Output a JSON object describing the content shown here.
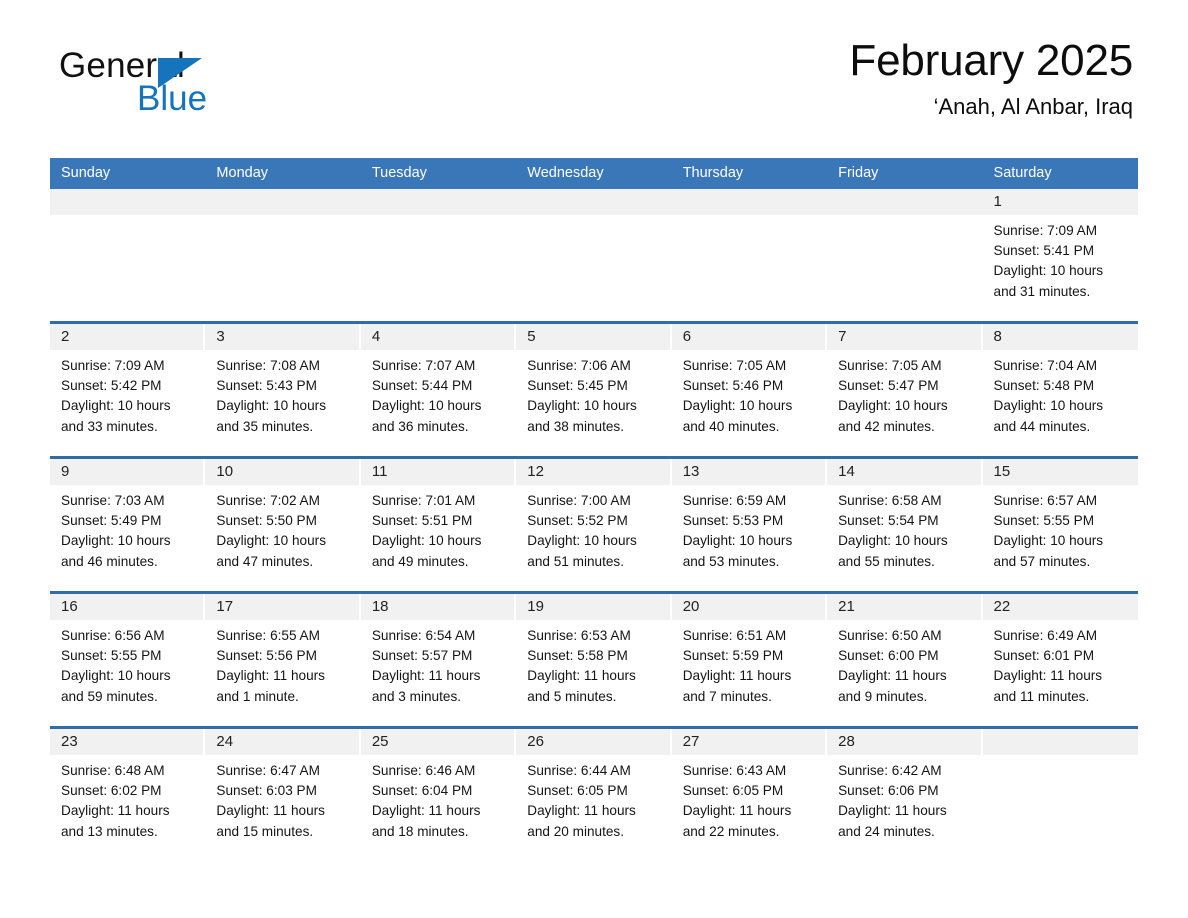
{
  "brand": {
    "name_part1": "General",
    "name_part2": "Blue",
    "accent_color": "#1574bb",
    "triangle_icon": "triangle-icon"
  },
  "header": {
    "month_title": "February 2025",
    "location": "‘Anah, Al Anbar, Iraq"
  },
  "calendar": {
    "header_color": "#3a77b8",
    "row_separator_color": "#2f6ca8",
    "daynum_strip_color": "#f1f1f1",
    "weekdays": [
      "Sunday",
      "Monday",
      "Tuesday",
      "Wednesday",
      "Thursday",
      "Friday",
      "Saturday"
    ],
    "weeks": [
      [
        {
          "empty": true
        },
        {
          "empty": true
        },
        {
          "empty": true
        },
        {
          "empty": true
        },
        {
          "empty": true
        },
        {
          "empty": true
        },
        {
          "day": "1",
          "sunrise": "Sunrise: 7:09 AM",
          "sunset": "Sunset: 5:41 PM",
          "daylight": "Daylight: 10 hours and 31 minutes."
        }
      ],
      [
        {
          "day": "2",
          "sunrise": "Sunrise: 7:09 AM",
          "sunset": "Sunset: 5:42 PM",
          "daylight": "Daylight: 10 hours and 33 minutes."
        },
        {
          "day": "3",
          "sunrise": "Sunrise: 7:08 AM",
          "sunset": "Sunset: 5:43 PM",
          "daylight": "Daylight: 10 hours and 35 minutes."
        },
        {
          "day": "4",
          "sunrise": "Sunrise: 7:07 AM",
          "sunset": "Sunset: 5:44 PM",
          "daylight": "Daylight: 10 hours and 36 minutes."
        },
        {
          "day": "5",
          "sunrise": "Sunrise: 7:06 AM",
          "sunset": "Sunset: 5:45 PM",
          "daylight": "Daylight: 10 hours and 38 minutes."
        },
        {
          "day": "6",
          "sunrise": "Sunrise: 7:05 AM",
          "sunset": "Sunset: 5:46 PM",
          "daylight": "Daylight: 10 hours and 40 minutes."
        },
        {
          "day": "7",
          "sunrise": "Sunrise: 7:05 AM",
          "sunset": "Sunset: 5:47 PM",
          "daylight": "Daylight: 10 hours and 42 minutes."
        },
        {
          "day": "8",
          "sunrise": "Sunrise: 7:04 AM",
          "sunset": "Sunset: 5:48 PM",
          "daylight": "Daylight: 10 hours and 44 minutes."
        }
      ],
      [
        {
          "day": "9",
          "sunrise": "Sunrise: 7:03 AM",
          "sunset": "Sunset: 5:49 PM",
          "daylight": "Daylight: 10 hours and 46 minutes."
        },
        {
          "day": "10",
          "sunrise": "Sunrise: 7:02 AM",
          "sunset": "Sunset: 5:50 PM",
          "daylight": "Daylight: 10 hours and 47 minutes."
        },
        {
          "day": "11",
          "sunrise": "Sunrise: 7:01 AM",
          "sunset": "Sunset: 5:51 PM",
          "daylight": "Daylight: 10 hours and 49 minutes."
        },
        {
          "day": "12",
          "sunrise": "Sunrise: 7:00 AM",
          "sunset": "Sunset: 5:52 PM",
          "daylight": "Daylight: 10 hours and 51 minutes."
        },
        {
          "day": "13",
          "sunrise": "Sunrise: 6:59 AM",
          "sunset": "Sunset: 5:53 PM",
          "daylight": "Daylight: 10 hours and 53 minutes."
        },
        {
          "day": "14",
          "sunrise": "Sunrise: 6:58 AM",
          "sunset": "Sunset: 5:54 PM",
          "daylight": "Daylight: 10 hours and 55 minutes."
        },
        {
          "day": "15",
          "sunrise": "Sunrise: 6:57 AM",
          "sunset": "Sunset: 5:55 PM",
          "daylight": "Daylight: 10 hours and 57 minutes."
        }
      ],
      [
        {
          "day": "16",
          "sunrise": "Sunrise: 6:56 AM",
          "sunset": "Sunset: 5:55 PM",
          "daylight": "Daylight: 10 hours and 59 minutes."
        },
        {
          "day": "17",
          "sunrise": "Sunrise: 6:55 AM",
          "sunset": "Sunset: 5:56 PM",
          "daylight": "Daylight: 11 hours and 1 minute."
        },
        {
          "day": "18",
          "sunrise": "Sunrise: 6:54 AM",
          "sunset": "Sunset: 5:57 PM",
          "daylight": "Daylight: 11 hours and 3 minutes."
        },
        {
          "day": "19",
          "sunrise": "Sunrise: 6:53 AM",
          "sunset": "Sunset: 5:58 PM",
          "daylight": "Daylight: 11 hours and 5 minutes."
        },
        {
          "day": "20",
          "sunrise": "Sunrise: 6:51 AM",
          "sunset": "Sunset: 5:59 PM",
          "daylight": "Daylight: 11 hours and 7 minutes."
        },
        {
          "day": "21",
          "sunrise": "Sunrise: 6:50 AM",
          "sunset": "Sunset: 6:00 PM",
          "daylight": "Daylight: 11 hours and 9 minutes."
        },
        {
          "day": "22",
          "sunrise": "Sunrise: 6:49 AM",
          "sunset": "Sunset: 6:01 PM",
          "daylight": "Daylight: 11 hours and 11 minutes."
        }
      ],
      [
        {
          "day": "23",
          "sunrise": "Sunrise: 6:48 AM",
          "sunset": "Sunset: 6:02 PM",
          "daylight": "Daylight: 11 hours and 13 minutes."
        },
        {
          "day": "24",
          "sunrise": "Sunrise: 6:47 AM",
          "sunset": "Sunset: 6:03 PM",
          "daylight": "Daylight: 11 hours and 15 minutes."
        },
        {
          "day": "25",
          "sunrise": "Sunrise: 6:46 AM",
          "sunset": "Sunset: 6:04 PM",
          "daylight": "Daylight: 11 hours and 18 minutes."
        },
        {
          "day": "26",
          "sunrise": "Sunrise: 6:44 AM",
          "sunset": "Sunset: 6:05 PM",
          "daylight": "Daylight: 11 hours and 20 minutes."
        },
        {
          "day": "27",
          "sunrise": "Sunrise: 6:43 AM",
          "sunset": "Sunset: 6:05 PM",
          "daylight": "Daylight: 11 hours and 22 minutes."
        },
        {
          "day": "28",
          "sunrise": "Sunrise: 6:42 AM",
          "sunset": "Sunset: 6:06 PM",
          "daylight": "Daylight: 11 hours and 24 minutes."
        },
        {
          "empty": true
        }
      ]
    ]
  }
}
